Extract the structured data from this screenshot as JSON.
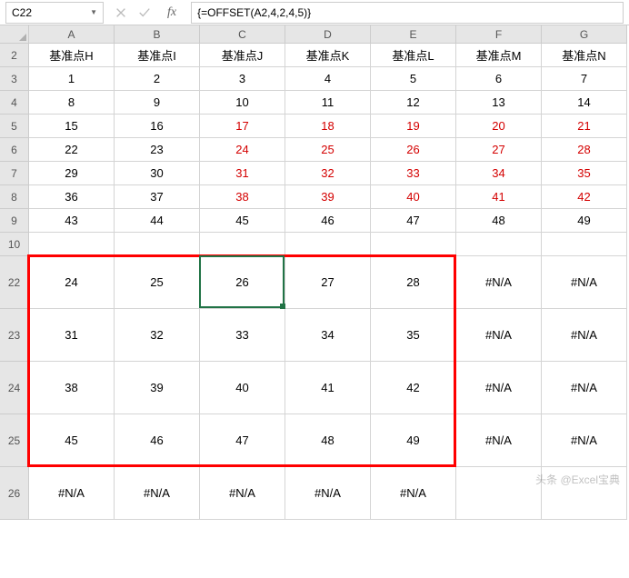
{
  "nameBox": {
    "value": "C22"
  },
  "formulaBar": {
    "value": "{=OFFSET(A2,4,2,4,5)}"
  },
  "columns": [
    "A",
    "B",
    "C",
    "D",
    "E",
    "F",
    "G"
  ],
  "rows": [
    {
      "num": "2",
      "h": "short",
      "cells": [
        {
          "v": "基准点H"
        },
        {
          "v": "基准点I"
        },
        {
          "v": "基准点J"
        },
        {
          "v": "基准点K"
        },
        {
          "v": "基准点L"
        },
        {
          "v": "基准点M"
        },
        {
          "v": "基准点N"
        }
      ]
    },
    {
      "num": "3",
      "h": "short",
      "cells": [
        {
          "v": "1"
        },
        {
          "v": "2"
        },
        {
          "v": "3"
        },
        {
          "v": "4"
        },
        {
          "v": "5"
        },
        {
          "v": "6"
        },
        {
          "v": "7"
        }
      ]
    },
    {
      "num": "4",
      "h": "short",
      "cells": [
        {
          "v": "8"
        },
        {
          "v": "9"
        },
        {
          "v": "10"
        },
        {
          "v": "11"
        },
        {
          "v": "12"
        },
        {
          "v": "13"
        },
        {
          "v": "14"
        }
      ]
    },
    {
      "num": "5",
      "h": "short",
      "cells": [
        {
          "v": "15"
        },
        {
          "v": "16"
        },
        {
          "v": "17",
          "r": true
        },
        {
          "v": "18",
          "r": true
        },
        {
          "v": "19",
          "r": true
        },
        {
          "v": "20",
          "r": true
        },
        {
          "v": "21",
          "r": true
        }
      ]
    },
    {
      "num": "6",
      "h": "short",
      "cells": [
        {
          "v": "22"
        },
        {
          "v": "23"
        },
        {
          "v": "24",
          "r": true
        },
        {
          "v": "25",
          "r": true
        },
        {
          "v": "26",
          "r": true
        },
        {
          "v": "27",
          "r": true
        },
        {
          "v": "28",
          "r": true
        }
      ]
    },
    {
      "num": "7",
      "h": "short",
      "cells": [
        {
          "v": "29"
        },
        {
          "v": "30"
        },
        {
          "v": "31",
          "r": true
        },
        {
          "v": "32",
          "r": true
        },
        {
          "v": "33",
          "r": true
        },
        {
          "v": "34",
          "r": true
        },
        {
          "v": "35",
          "r": true
        }
      ]
    },
    {
      "num": "8",
      "h": "short",
      "cells": [
        {
          "v": "36"
        },
        {
          "v": "37"
        },
        {
          "v": "38",
          "r": true
        },
        {
          "v": "39",
          "r": true
        },
        {
          "v": "40",
          "r": true
        },
        {
          "v": "41",
          "r": true
        },
        {
          "v": "42",
          "r": true
        }
      ]
    },
    {
      "num": "9",
      "h": "short",
      "cells": [
        {
          "v": "43"
        },
        {
          "v": "44"
        },
        {
          "v": "45"
        },
        {
          "v": "46"
        },
        {
          "v": "47"
        },
        {
          "v": "48"
        },
        {
          "v": "49"
        }
      ]
    },
    {
      "num": "10",
      "h": "short",
      "cells": [
        {
          "v": ""
        },
        {
          "v": ""
        },
        {
          "v": ""
        },
        {
          "v": ""
        },
        {
          "v": ""
        },
        {
          "v": ""
        },
        {
          "v": ""
        }
      ]
    },
    {
      "num": "22",
      "h": "tall",
      "cells": [
        {
          "v": "24"
        },
        {
          "v": "25"
        },
        {
          "v": "26"
        },
        {
          "v": "27"
        },
        {
          "v": "28"
        },
        {
          "v": "#N/A"
        },
        {
          "v": "#N/A"
        }
      ]
    },
    {
      "num": "23",
      "h": "tall",
      "cells": [
        {
          "v": "31"
        },
        {
          "v": "32"
        },
        {
          "v": "33"
        },
        {
          "v": "34"
        },
        {
          "v": "35"
        },
        {
          "v": "#N/A"
        },
        {
          "v": "#N/A"
        }
      ]
    },
    {
      "num": "24",
      "h": "tall",
      "cells": [
        {
          "v": "38"
        },
        {
          "v": "39"
        },
        {
          "v": "40"
        },
        {
          "v": "41"
        },
        {
          "v": "42"
        },
        {
          "v": "#N/A"
        },
        {
          "v": "#N/A"
        }
      ]
    },
    {
      "num": "25",
      "h": "tall",
      "cells": [
        {
          "v": "45"
        },
        {
          "v": "46"
        },
        {
          "v": "47"
        },
        {
          "v": "48"
        },
        {
          "v": "49"
        },
        {
          "v": "#N/A"
        },
        {
          "v": "#N/A"
        }
      ]
    },
    {
      "num": "26",
      "h": "tall",
      "cells": [
        {
          "v": "#N/A"
        },
        {
          "v": "#N/A"
        },
        {
          "v": "#N/A"
        },
        {
          "v": "#N/A"
        },
        {
          "v": "#N/A"
        },
        {
          "v": ""
        },
        {
          "v": ""
        }
      ]
    }
  ],
  "watermark": "头条 @Excel宝典",
  "selection": {
    "row": 9,
    "col": 2
  },
  "redBox": {
    "topRow": 9,
    "leftCol": 0,
    "rows": 4,
    "cols": 5
  }
}
